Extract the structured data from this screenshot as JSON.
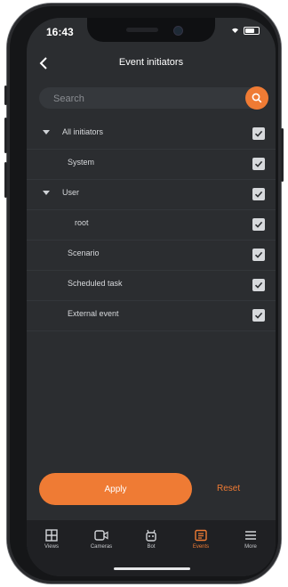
{
  "status": {
    "time": "16:43"
  },
  "header": {
    "title": "Event initiators"
  },
  "search": {
    "placeholder": "Search"
  },
  "initiators": [
    {
      "label": "All initiators",
      "level": 0,
      "expandable": true,
      "checked": true
    },
    {
      "label": "System",
      "level": 1,
      "expandable": false,
      "checked": true
    },
    {
      "label": "User",
      "level": 0,
      "expandable": true,
      "checked": true
    },
    {
      "label": "root",
      "level": 2,
      "expandable": false,
      "checked": true
    },
    {
      "label": "Scenario",
      "level": 1,
      "expandable": false,
      "checked": true
    },
    {
      "label": "Scheduled task",
      "level": 1,
      "expandable": false,
      "checked": true
    },
    {
      "label": "External event",
      "level": 1,
      "expandable": false,
      "checked": true
    }
  ],
  "actions": {
    "apply": "Apply",
    "reset": "Reset"
  },
  "tabs": [
    {
      "label": "Views",
      "icon": "views-icon",
      "active": false
    },
    {
      "label": "Cameras",
      "icon": "camera-icon",
      "active": false
    },
    {
      "label": "Bot",
      "icon": "bot-icon",
      "active": false
    },
    {
      "label": "Events",
      "icon": "events-icon",
      "active": true
    },
    {
      "label": "More",
      "icon": "menu-icon",
      "active": false
    }
  ],
  "colors": {
    "accent": "#ef7b34",
    "background": "#2b2d30",
    "tabbar": "#1f2023"
  }
}
